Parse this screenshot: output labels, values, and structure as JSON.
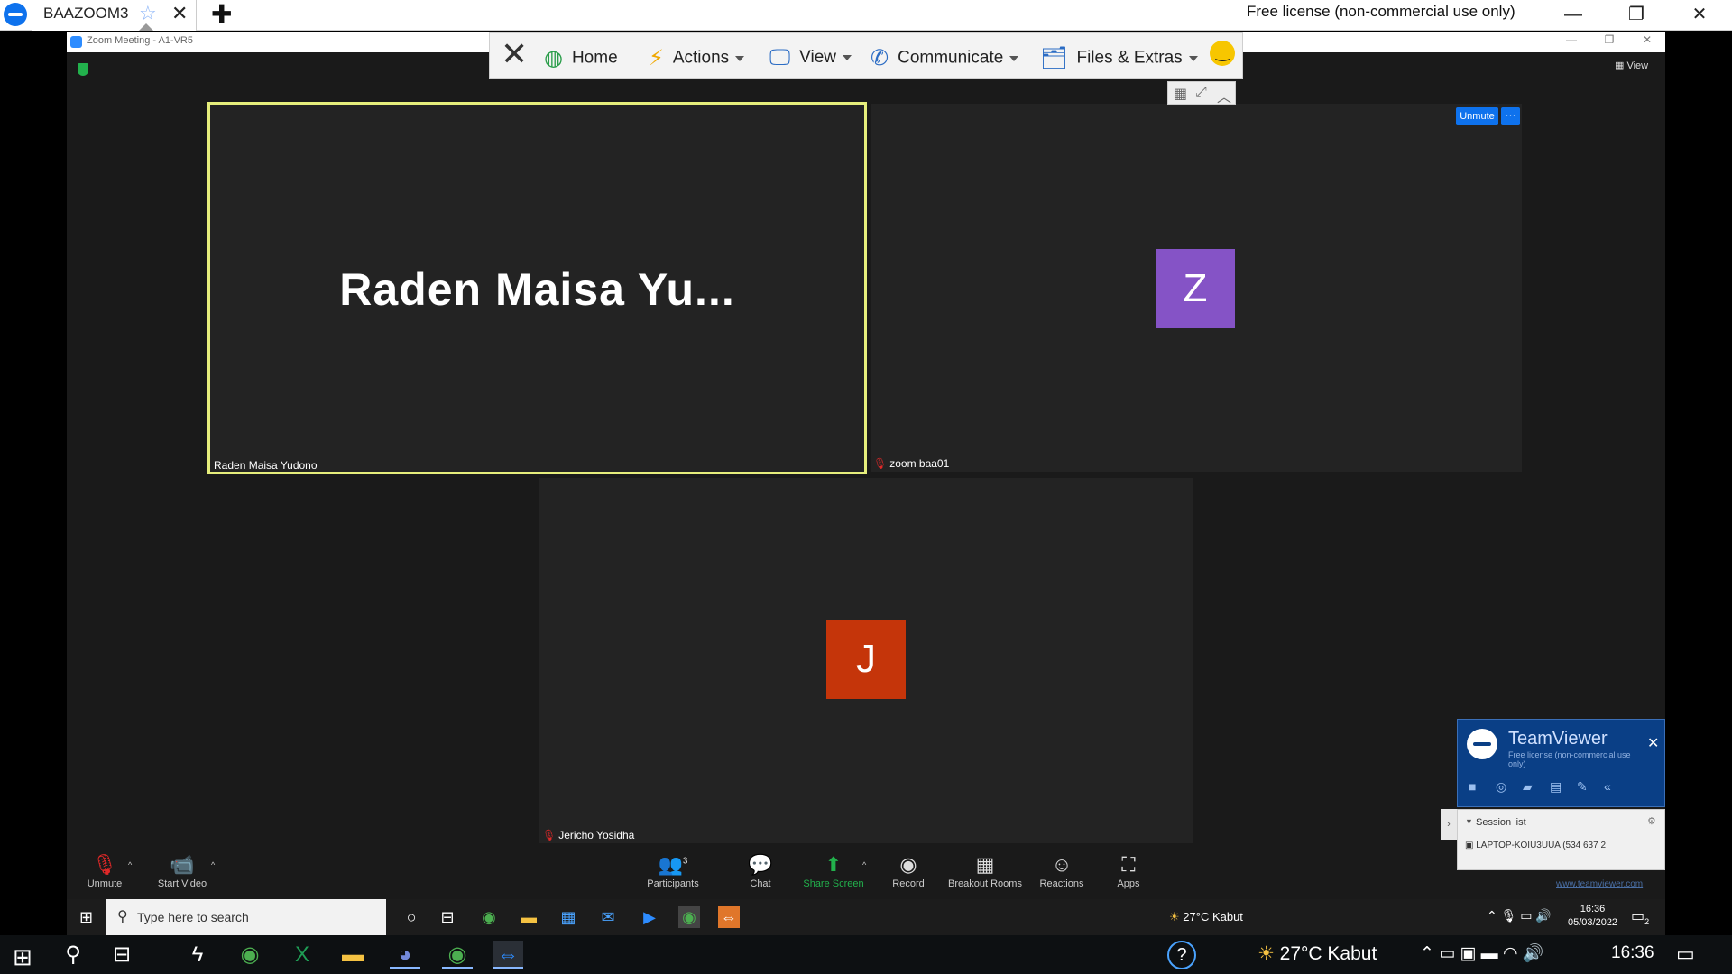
{
  "tv_tab": {
    "title": "BAAZOOM3",
    "star": "☆",
    "close": "✕",
    "new_tab": "✚"
  },
  "tv_license": "Free license (non-commercial use only)",
  "window_controls": {
    "minimize": "—",
    "restore": "❐",
    "close": "✕"
  },
  "zoom": {
    "window_title": "Zoom Meeting - A1-VR5",
    "view_label": "▦ View",
    "toolbar": {
      "home": "Home",
      "actions": "Actions",
      "view": "View",
      "communicate": "Communicate",
      "files": "Files & Extras"
    },
    "tiles": [
      {
        "display_name": "Raden  Maisa  Yu...",
        "label": "Raden Maisa Yudono"
      },
      {
        "avatar": "Z",
        "label": "zoom baa01",
        "unmute": "Unmute",
        "more": "···"
      },
      {
        "avatar": "J",
        "label": "Jericho Yosidha"
      }
    ],
    "controls": {
      "unmute": "Unmute",
      "start_video": "Start Video",
      "participants": "Participants",
      "participants_count": "3",
      "chat": "Chat",
      "share_screen": "Share Screen",
      "record": "Record",
      "breakout_rooms": "Breakout Rooms",
      "reactions": "Reactions",
      "apps": "Apps"
    },
    "colors": {
      "active_speaker": "#e6ee7c",
      "avatar_z": "#8553c6",
      "avatar_j": "#c5350a",
      "share_green": "#22b14c",
      "accent": "#0e72ed"
    }
  },
  "tv_panel": {
    "title": "TeamViewer",
    "subtitle": "Free license (non-commercial use only)",
    "close": "✕",
    "session_list": "Session list",
    "session_item": "LAPTOP-KOIU3UUA (534 637 2",
    "url": "www.teamviewer.com"
  },
  "inner_taskbar": {
    "search_placeholder": "Type here to search",
    "weather": "27°C  Kabut",
    "time": "16:36",
    "date": "05/03/2022",
    "notif_count": "2"
  },
  "local_taskbar": {
    "weather": "27°C  Kabut",
    "time": "16:36"
  }
}
